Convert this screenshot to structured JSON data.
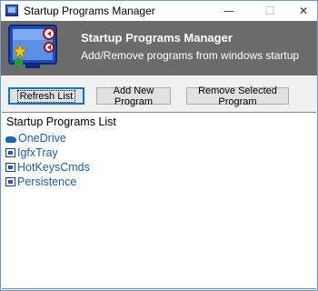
{
  "window": {
    "title": "Startup Programs Manager",
    "minimize_glyph": "—",
    "maximize_glyph": "☐",
    "close_glyph": "✕"
  },
  "banner": {
    "title": "Startup Programs Manager",
    "subtitle": "Add/Remove programs from windows startup",
    "background": "#6b6b6b"
  },
  "toolbar": {
    "refresh_label": "Refresh List",
    "add_label": "Add New Program",
    "remove_label": "Remove Selected Program"
  },
  "list": {
    "heading": "Startup Programs List",
    "link_color": "#1a5fb4",
    "items": [
      {
        "label": "OneDrive",
        "icon": "onedrive-icon"
      },
      {
        "label": "IgfxTray",
        "icon": "program-icon"
      },
      {
        "label": "HotKeysCmds",
        "icon": "program-icon"
      },
      {
        "label": "Persistence",
        "icon": "program-icon"
      }
    ]
  }
}
